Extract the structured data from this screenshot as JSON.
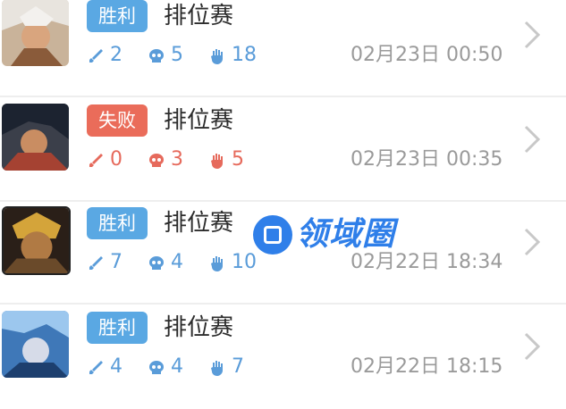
{
  "colors": {
    "win": "#5aa8e3",
    "loss": "#ea6c5a",
    "text": "#2c2c2c",
    "meta": "#9a9a9a"
  },
  "matches": [
    {
      "result": "胜利",
      "outcome": "win",
      "mode": "排位赛",
      "kills": "2",
      "deaths": "5",
      "assists": "18",
      "time": "02月23日 00:50"
    },
    {
      "result": "失败",
      "outcome": "loss",
      "mode": "排位赛",
      "kills": "0",
      "deaths": "3",
      "assists": "5",
      "time": "02月23日 00:35"
    },
    {
      "result": "胜利",
      "outcome": "win",
      "mode": "排位赛",
      "kills": "7",
      "deaths": "4",
      "assists": "10",
      "time": "02月22日 18:34"
    },
    {
      "result": "胜利",
      "outcome": "win",
      "mode": "排位赛",
      "kills": "4",
      "deaths": "4",
      "assists": "7",
      "time": "02月22日 18:15"
    }
  ],
  "icons": {
    "kills": "sword-icon",
    "deaths": "skull-icon",
    "assists": "hand-icon",
    "more": "chevron-right-icon"
  },
  "watermark": {
    "text": "领域圈"
  }
}
